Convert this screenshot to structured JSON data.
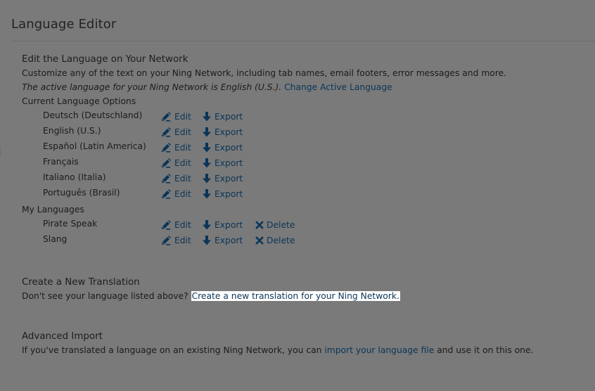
{
  "page": {
    "title": "Language Editor"
  },
  "edit_section": {
    "heading": "Edit the Language on Your Network",
    "description": "Customize any of the text on your Ning Network, including tab names, email footers, error messages and more.",
    "active_note": "The active language for your Ning Network is English (U.S.).",
    "change_link": "Change Active Language"
  },
  "current_options": {
    "heading": "Current Language Options",
    "languages": [
      "Deutsch (Deutschland)",
      "English (U.S.)",
      "Español (Latin America)",
      "Français",
      "Italiano (Italia)",
      "Português (Brasil)"
    ]
  },
  "my_languages": {
    "heading": "My Languages",
    "languages": [
      "Pirate Speak",
      "Slang"
    ]
  },
  "actions": {
    "edit": "Edit",
    "export": "Export",
    "delete": "Delete"
  },
  "create_section": {
    "heading": "Create a New Translation",
    "prompt": "Don't see your language listed above?",
    "link": "Create a new translation for your Ning Network."
  },
  "advanced_import": {
    "heading": "Advanced Import",
    "prefix": "If you've translated a language on an existing Ning Network, you can",
    "link": "import your language file",
    "suffix": "and use it on this one."
  },
  "colors": {
    "background": "#7a7a7a",
    "link": "#0a3558",
    "highlight": "#ffffff"
  },
  "icons": {
    "edit": "pencil-icon",
    "export": "arrow-down-icon",
    "delete": "x-icon"
  }
}
